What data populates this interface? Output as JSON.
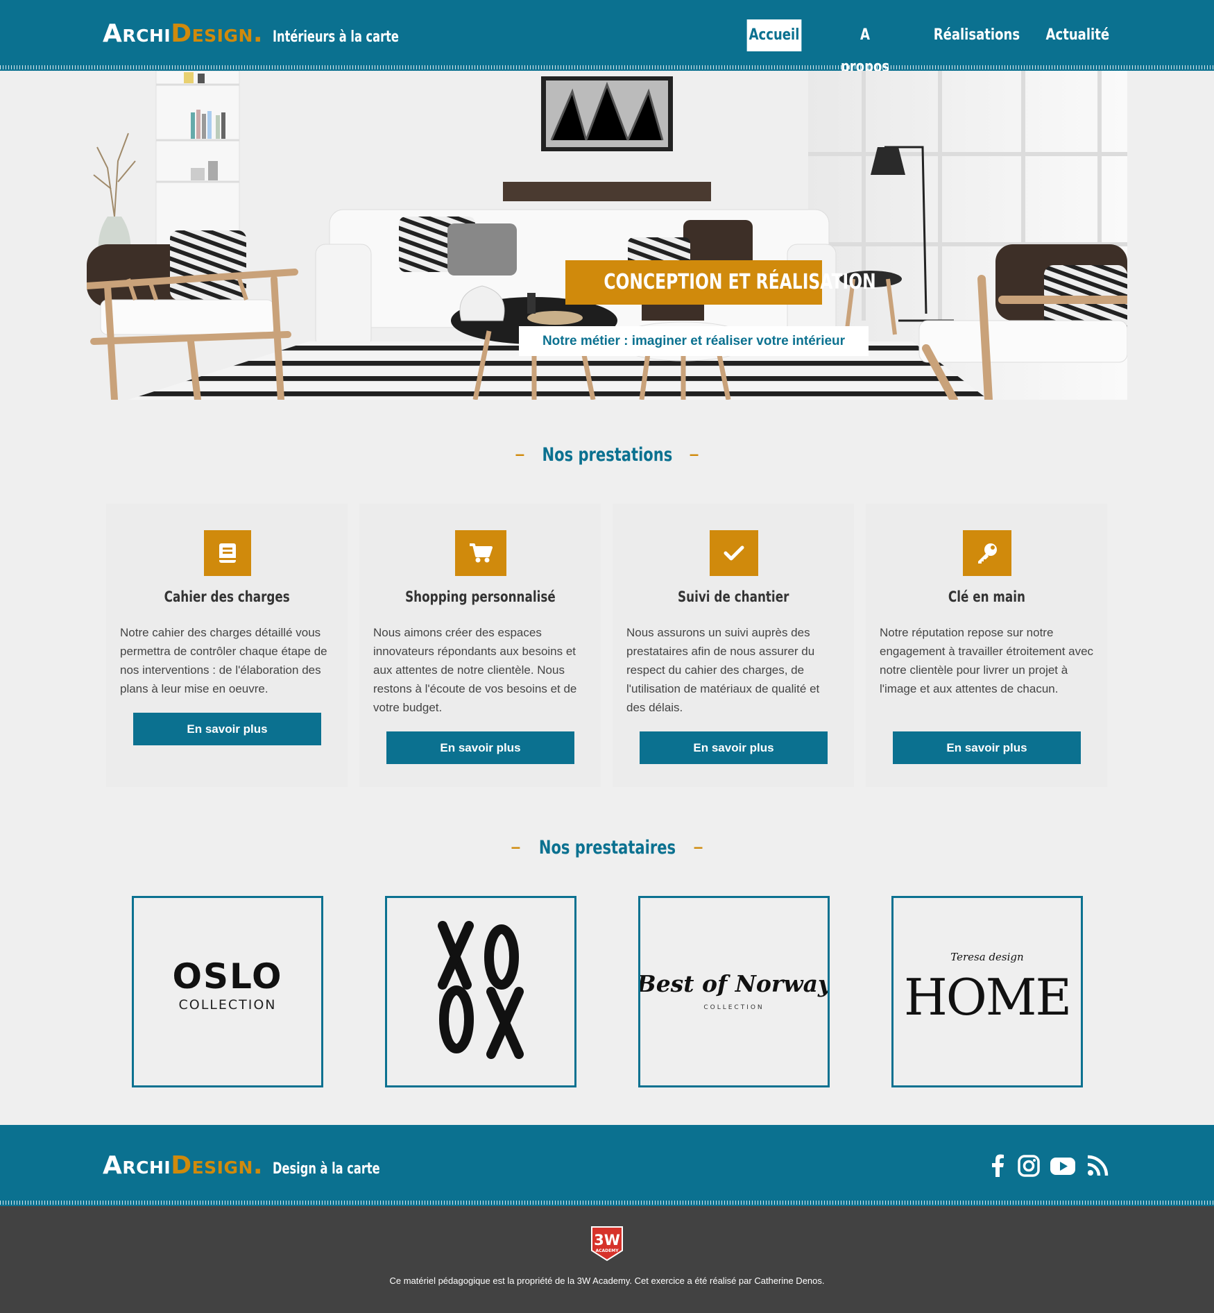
{
  "colors": {
    "primary": "#0b7190",
    "accent": "#d08a0c",
    "background": "#efefef",
    "dark": "#424242"
  },
  "brand": {
    "archi": "Archi",
    "design": "Design.",
    "tagline": "Intérieurs à la carte",
    "footer_tagline": "Design à la carte"
  },
  "nav": [
    {
      "label": "Accueil",
      "active": true
    },
    {
      "label": "A propos",
      "active": false
    },
    {
      "label": "Réalisations",
      "active": false
    },
    {
      "label": "Actualité",
      "active": false
    }
  ],
  "hero": {
    "title": "CONCEPTION ET RÉALISATION",
    "subtitle": "Notre métier : imaginer et réaliser votre intérieur"
  },
  "services": {
    "title": "Nos prestations",
    "items": [
      {
        "icon": "book-icon",
        "title": "Cahier des charges",
        "text": "Notre cahier des charges détaillé vous permettra de contrôler chaque étape de nos interventions : de l'élaboration des plans à leur mise en oeuvre.",
        "button": "En savoir plus"
      },
      {
        "icon": "cart-icon",
        "title": "Shopping personnalisé",
        "text": "Nous aimons créer des espaces innovateurs répondants aux besoins et aux attentes de notre clientèle. Nous restons à l'écoute de vos besoins et de votre budget.",
        "button": "En savoir plus"
      },
      {
        "icon": "check-icon",
        "title": "Suivi de chantier",
        "text": "Nous assurons un suivi auprès des prestataires afin de nous assurer du respect du cahier des charges, de l'utilisation de matériaux de qualité et des délais.",
        "button": "En savoir plus"
      },
      {
        "icon": "key-icon",
        "title": "Clé en main",
        "text": "Notre réputation repose sur notre engagement à travailler étroitement avec notre clientèle pour livrer un projet à l'image et aux attentes de chacun.",
        "button": "En savoir plus"
      }
    ]
  },
  "partners": {
    "title": "Nos prestataires",
    "items": [
      {
        "name": "OSLO",
        "sub": "COLLECTION"
      },
      {
        "name": "XOOX",
        "sub": ""
      },
      {
        "name": "Best of Norway",
        "sub": "COLLECTION"
      },
      {
        "name": "HOME",
        "sub": "Teresa design"
      }
    ]
  },
  "social": [
    "facebook-icon",
    "instagram-icon",
    "youtube-icon",
    "rss-icon"
  ],
  "subfooter": {
    "badge_top": "3W",
    "badge_bottom": "ACADEMY",
    "copyright": "Ce matériel pédagogique est la propriété de la 3W Academy. Cet exercice a été réalisé par Catherine Denos."
  }
}
